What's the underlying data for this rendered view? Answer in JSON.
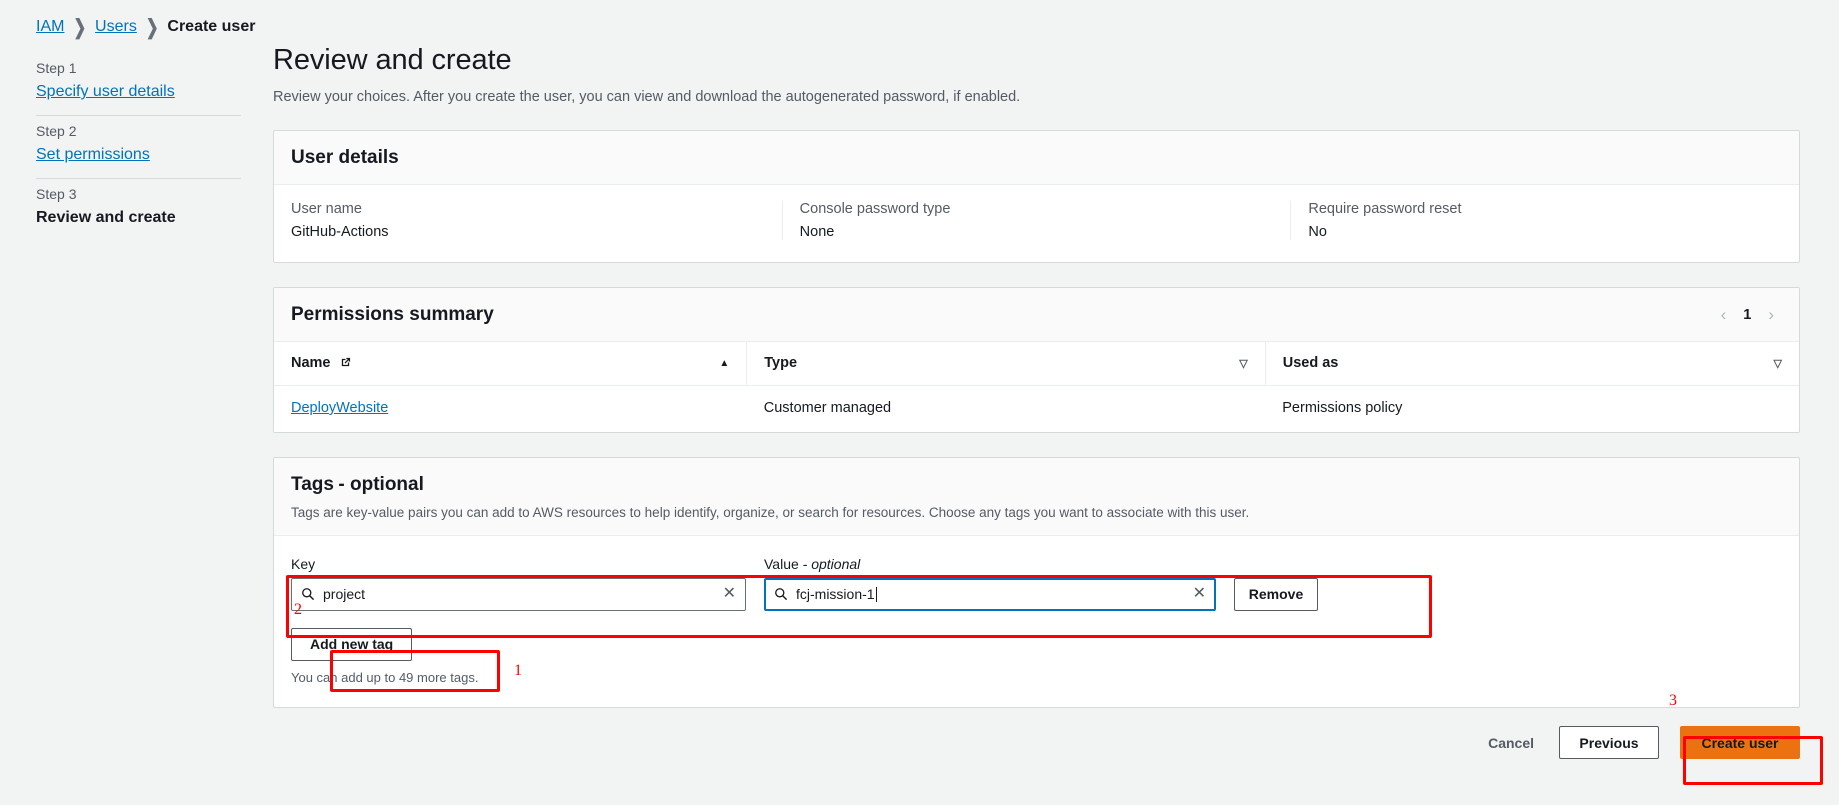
{
  "breadcrumb": {
    "items": [
      {
        "label": "IAM",
        "link": true
      },
      {
        "label": "Users",
        "link": true
      },
      {
        "label": "Create user",
        "link": false
      }
    ],
    "separator": "❯"
  },
  "sidebar": {
    "steps": [
      {
        "step_label": "Step 1",
        "title": "Specify user details",
        "current": false
      },
      {
        "step_label": "Step 2",
        "title": "Set permissions",
        "current": false
      },
      {
        "step_label": "Step 3",
        "title": "Review and create",
        "current": true
      }
    ]
  },
  "main": {
    "title": "Review and create",
    "subtitle": "Review your choices. After you create the user, you can view and download the autogenerated password, if enabled."
  },
  "user_details": {
    "card_title": "User details",
    "fields": [
      {
        "label": "User name",
        "value": "GitHub-Actions"
      },
      {
        "label": "Console password type",
        "value": "None"
      },
      {
        "label": "Require password reset",
        "value": "No"
      }
    ]
  },
  "permissions_summary": {
    "card_title": "Permissions summary",
    "pagination": {
      "prev": "‹",
      "page": "1",
      "next": "›"
    },
    "columns": [
      {
        "label": "Name",
        "sort": "asc",
        "sort_glyph": "▲",
        "external_link_icon": true
      },
      {
        "label": "Type",
        "sort": "none",
        "sort_glyph": "▽",
        "external_link_icon": false
      },
      {
        "label": "Used as",
        "sort": "none",
        "sort_glyph": "▽",
        "external_link_icon": false
      }
    ],
    "rows": [
      {
        "name": "DeployWebsite",
        "type": "Customer managed",
        "used_as": "Permissions policy"
      }
    ]
  },
  "tags": {
    "card_title": "Tags",
    "card_title_optional": "- optional",
    "description": "Tags are key-value pairs you can add to AWS resources to help identify, organize, or search for resources. Choose any tags you want to associate with this user.",
    "key_label": "Key",
    "value_label": "Value",
    "value_label_optional": "- optional",
    "key_value": "project",
    "value_value": "fcj-mission-1",
    "remove_label": "Remove",
    "add_tag_label": "Add new tag",
    "more_tags_note": "You can add up to 49 more tags."
  },
  "footer": {
    "cancel_label": "Cancel",
    "previous_label": "Previous",
    "create_label": "Create user"
  },
  "annotations": {
    "marker_1": "1",
    "marker_2": "2",
    "marker_3": "3",
    "color": "#ff0000"
  },
  "colors": {
    "accent_link": "#0073bb",
    "primary_button": "#ec7211",
    "annotation": "#ff0000",
    "background": "#f2f3f3"
  }
}
